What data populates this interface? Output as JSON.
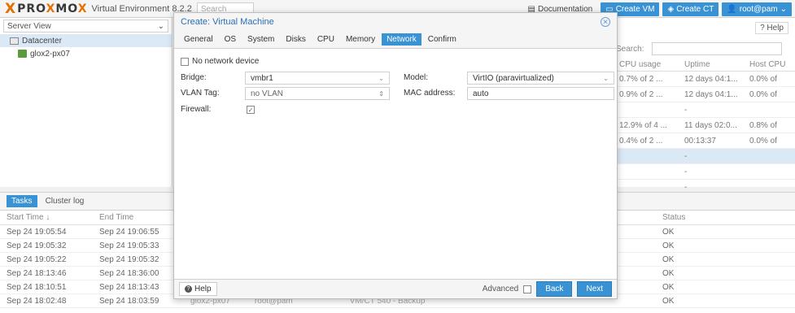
{
  "topbar": {
    "logo_x": "X",
    "logo_pr": "PRO",
    "logo_x2": "X",
    "logo_mo": "MO",
    "logo_x3": "X",
    "version": "Virtual Environment 8.2.2",
    "search_placeholder": "Search",
    "documentation": "Documentation",
    "create_vm": "Create VM",
    "create_ct": "Create CT",
    "user": "root@pam"
  },
  "sidebar": {
    "view": "Server View",
    "items": [
      {
        "label": "Datacenter"
      },
      {
        "label": "glox2-px07"
      }
    ]
  },
  "content": {
    "help": "Help",
    "search_label": "Search:",
    "columns": [
      "CPU usage",
      "Uptime",
      "Host CPU"
    ],
    "rows": [
      {
        "cpu": "0.7% of 2 ...",
        "uptime": "12 days 04:1...",
        "host": "0.0% of"
      },
      {
        "cpu": "0.9% of 2 ...",
        "uptime": "12 days 04:1...",
        "host": "0.0% of"
      },
      {
        "cpu": "",
        "uptime": "-",
        "host": ""
      },
      {
        "cpu": "12.9% of 4 ...",
        "uptime": "11 days 02:0...",
        "host": "0.8% of"
      },
      {
        "cpu": "0.4% of 2 ...",
        "uptime": "00:13:37",
        "host": "0.0% of"
      },
      {
        "cpu": "",
        "uptime": "-",
        "host": ""
      },
      {
        "cpu": "",
        "uptime": "-",
        "host": ""
      },
      {
        "cpu": "",
        "uptime": "-",
        "host": ""
      }
    ]
  },
  "log": {
    "tabs": [
      "Tasks",
      "Cluster log"
    ],
    "columns": {
      "start": "Start Time ↓",
      "end": "End Time",
      "status": "Status"
    },
    "rows": [
      {
        "start": "Sep 24 19:05:54",
        "end": "Sep 24 19:06:55",
        "status": "OK"
      },
      {
        "start": "Sep 24 19:05:32",
        "end": "Sep 24 19:05:33",
        "status": "OK"
      },
      {
        "start": "Sep 24 19:05:22",
        "end": "Sep 24 19:05:32",
        "status": "OK"
      },
      {
        "start": "Sep 24 18:13:46",
        "end": "Sep 24 18:36:00",
        "status": "OK"
      },
      {
        "start": "Sep 24 18:10:51",
        "end": "Sep 24 18:13:43",
        "status": "OK"
      },
      {
        "start": "Sep 24 18:02:48",
        "end": "Sep 24 18:03:59",
        "status": "OK",
        "node": "glox2-px07",
        "user": "root@pam",
        "desc": "VM/CT 540 - Backup"
      }
    ]
  },
  "modal": {
    "title": "Create: Virtual Machine",
    "tabs": [
      "General",
      "OS",
      "System",
      "Disks",
      "CPU",
      "Memory",
      "Network",
      "Confirm"
    ],
    "active_tab": "Network",
    "no_network_label": "No network device",
    "bridge_label": "Bridge:",
    "bridge_value": "vmbr1",
    "vlan_label": "VLAN Tag:",
    "vlan_value": "no VLAN",
    "firewall_label": "Firewall:",
    "model_label": "Model:",
    "model_value": "VirtIO (paravirtualized)",
    "mac_label": "MAC address:",
    "mac_value": "auto",
    "help": "Help",
    "advanced": "Advanced",
    "back": "Back",
    "next": "Next"
  },
  "colors": {
    "accent": "#3892d4",
    "brand": "#e57000"
  }
}
